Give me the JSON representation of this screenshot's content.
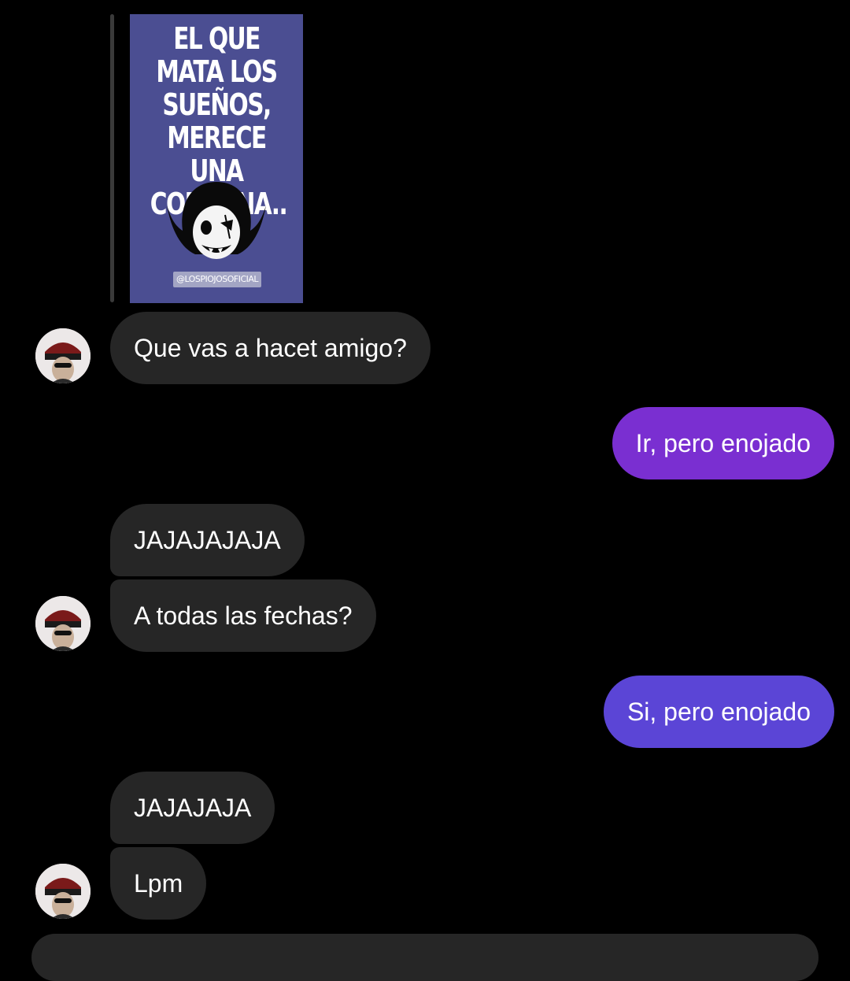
{
  "story_reply": {
    "poster_text": "EL QUE MATA LOS\nSUEÑOS,\nMERECE UNA\nCONDENA..",
    "handle": "@LOSPIOJOSOFICIAL"
  },
  "messages": [
    {
      "side": "in",
      "text": "Que vas a hacet amigo?"
    },
    {
      "side": "out",
      "text": "Ir, pero enojado"
    },
    {
      "side": "in",
      "text": "JAJAJAJAJA"
    },
    {
      "side": "in",
      "text": "A todas las fechas?"
    },
    {
      "side": "out",
      "text": "Si, pero enojado"
    },
    {
      "side": "in",
      "text": "JAJAJAJA"
    },
    {
      "side": "in",
      "text": "Lpm"
    }
  ],
  "colors": {
    "background": "#000000",
    "incoming_bubble": "#262626",
    "outgoing_bubble_top": "#7a2fd1",
    "outgoing_bubble_bottom": "#5b45d6",
    "story_bg": "#4b4e92"
  }
}
